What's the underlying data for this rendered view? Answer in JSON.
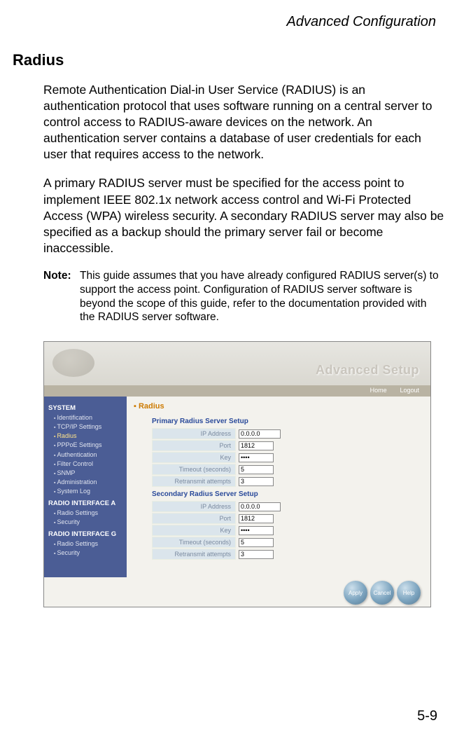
{
  "header": "Advanced Configuration",
  "section_title": "Radius",
  "paragraphs": {
    "p1": "Remote Authentication Dial-in User Service (RADIUS) is an authentication protocol that uses software running on a central server to control access to RADIUS-aware devices on the network. An authentication server contains a database of user credentials for each user that requires access to the network.",
    "p2": "A primary RADIUS server must be specified for the access point to implement IEEE 802.1x network access control and Wi-Fi Protected Access (WPA) wireless security. A secondary RADIUS server may also be specified as a backup should the primary server fail or become inaccessible."
  },
  "note": {
    "label": "Note:",
    "text": "This guide assumes that you have already configured RADIUS server(s) to support the access point. Configuration of RADIUS server software is beyond the scope of this guide, refer to the documentation provided with the RADIUS server software."
  },
  "screenshot": {
    "banner_title": "Advanced Setup",
    "nav": {
      "home": "Home",
      "logout": "Logout"
    },
    "sidebar": {
      "group1": "SYSTEM",
      "items1": [
        "Identification",
        "TCP/IP Settings",
        "Radius",
        "PPPoE Settings",
        "Authentication",
        "Filter Control",
        "SNMP",
        "Administration",
        "System Log"
      ],
      "group2": "RADIO INTERFACE A",
      "items2": [
        "Radio Settings",
        "Security"
      ],
      "group3": "RADIO INTERFACE G",
      "items3": [
        "Radio Settings",
        "Security"
      ]
    },
    "main": {
      "title": "Radius",
      "primary_heading": "Primary Radius Server Setup",
      "secondary_heading": "Secondary Radius Server Setup",
      "fields": {
        "ip": "IP Address",
        "port": "Port",
        "key": "Key",
        "timeout": "Timeout (seconds)",
        "retransmit": "Retransmit attempts"
      },
      "primary": {
        "ip": "0.0.0.0",
        "port": "1812",
        "key": "****",
        "timeout": "5",
        "retransmit": "3"
      },
      "secondary": {
        "ip": "0.0.0.0",
        "port": "1812",
        "key": "****",
        "timeout": "5",
        "retransmit": "3"
      }
    },
    "buttons": {
      "apply": "Apply",
      "cancel": "Cancel",
      "help": "Help"
    }
  },
  "page_number": "5-9"
}
